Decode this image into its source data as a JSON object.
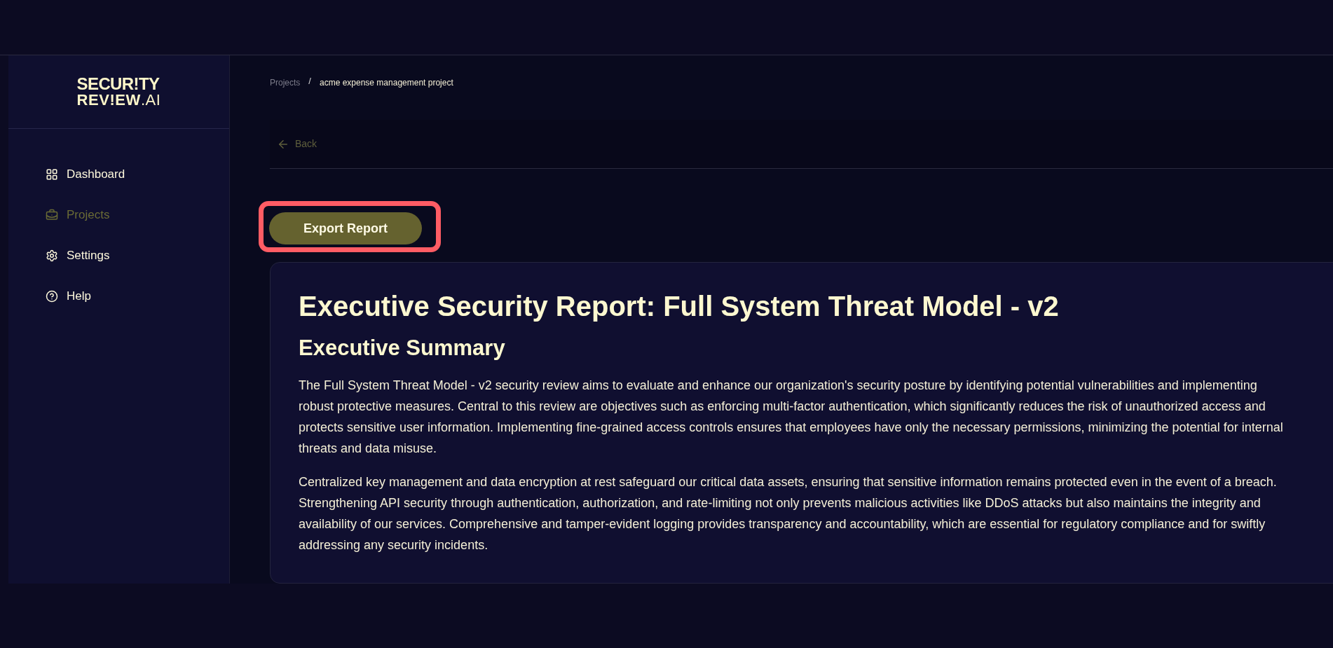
{
  "logo": {
    "line_1": "SECUR!TY",
    "line_2": "REV!EW",
    "suffix": ".AI"
  },
  "sidebar": {
    "items": [
      {
        "label": "Dashboard",
        "kind": "grid",
        "selected": false
      },
      {
        "label": "Projects",
        "kind": "briefcase",
        "selected": true
      },
      {
        "label": "Settings",
        "kind": "gear",
        "selected": false
      },
      {
        "label": "Help",
        "kind": "help",
        "selected": false
      }
    ]
  },
  "breadcrumb": [
    {
      "label": "Projects",
      "current": false
    },
    {
      "separator": "/"
    },
    {
      "label": "acme expense management project",
      "current": true
    }
  ],
  "back": {
    "label": "Back"
  },
  "export_button": {
    "label": "Export Report",
    "highlighted": true
  },
  "report": {
    "title": "Executive Security Report: Full System Threat Model - v2",
    "subtitle": "Executive Summary",
    "paragraphs": [
      "The Full System Threat Model - v2 security review aims to evaluate and enhance our organization's security posture by identifying potential vulnerabilities and implementing robust protective measures. Central to this review are objectives such as enforcing multi-factor authentication, which significantly reduces the risk of unauthorized access and protects sensitive user information. Implementing fine-grained access controls ensures that employees have only the necessary permissions, minimizing the potential for internal threats and data misuse.",
      "Centralized key management and data encryption at rest safeguard our critical data assets, ensuring that sensitive information remains protected even in the event of a breach. Strengthening API security through authentication, authorization, and rate-limiting not only prevents malicious activities like DDoS attacks but also maintains the integrity and availability of our services. Comprehensive and tamper-evident logging provides transparency and accountability, which are essential for regulatory compliance and for swiftly addressing any security incidents."
    ]
  }
}
